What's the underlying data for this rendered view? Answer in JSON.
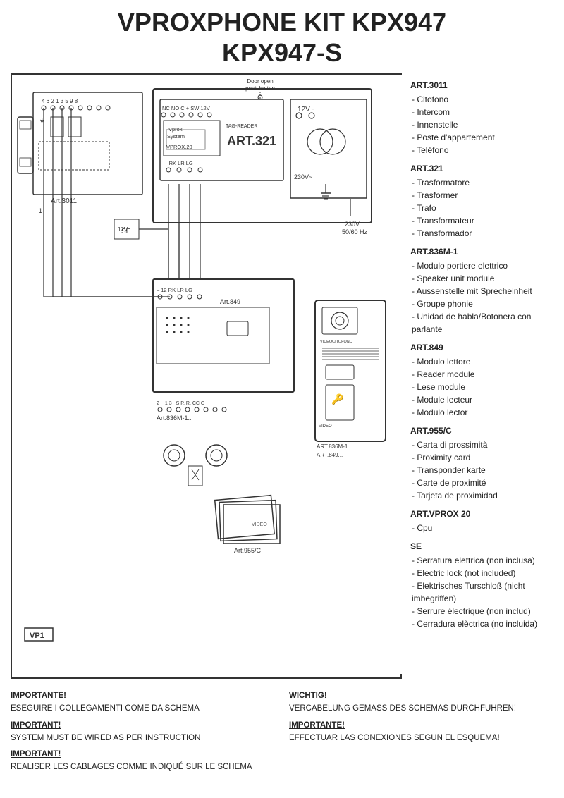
{
  "title": {
    "line1": "VPROXPHONE KIT KPX947",
    "line2": "KPX947-S"
  },
  "right_panel": {
    "sections": [
      {
        "id": "art3011",
        "title": "ART.3011",
        "items": [
          "Citofono",
          "Intercom",
          "Innenstelle",
          "Poste d'appartement",
          "Teléfono"
        ]
      },
      {
        "id": "art321",
        "title": "ART.321",
        "items": [
          "Trasformatore",
          "Trasformer",
          "Trafo",
          "Transformateur",
          "Transformador"
        ]
      },
      {
        "id": "art836m1",
        "title": "ART.836M-1",
        "items": [
          "Modulo portiere elettrico",
          "Speaker unit module",
          "Aussenstelle mit Sprecheinheit",
          "Groupe phonie",
          "Unidad de habla/Botonera con  parlante"
        ]
      },
      {
        "id": "art849",
        "title": "ART.849",
        "items": [
          "Modulo lettore",
          "Reader module",
          "Lese module",
          "Module lecteur",
          "Modulo lector"
        ]
      },
      {
        "id": "art955c",
        "title": "ART.955/C",
        "items": [
          "Carta di prossimità",
          "Proximity card",
          "Transponder karte",
          "Carte de proximité",
          "Tarjeta de proximidad"
        ]
      },
      {
        "id": "artvprox20",
        "title": "ART.VPROX 20",
        "items": [
          "Cpu"
        ]
      },
      {
        "id": "se",
        "title": "SE",
        "items": [
          "Serratura elettrica (non inclusa)",
          "Electric lock (not included)",
          "Elektrisches Turschloß (nicht imbegriffen)",
          "Serrure électrique (non includ)",
          "Cerradura elèctrica (no incluida)"
        ]
      }
    ]
  },
  "bottom_notes": {
    "col1": [
      {
        "heading": "IMPORTANTE!",
        "text": "ESEGUIRE I COLLEGAMENTI COME DA SCHEMA"
      },
      {
        "heading": "IMPORTANT!",
        "text": "SYSTEM MUST BE WIRED AS PER INSTRUCTION"
      },
      {
        "heading": "IMPORTANT!",
        "text": "REALISER LES CABLAGES COMME INDIQUÉ SUR LE SCHEMA"
      }
    ],
    "col2": [
      {
        "heading": "WICHTIG!",
        "text": "VERCABELUNG GEMASS DES SCHEMAS DURCHFUHREN!"
      },
      {
        "heading": "IMPORTANTE!",
        "text": "EFFECTUAR LAS CONEXIONES SEGUN EL ESQUEMA!"
      }
    ]
  },
  "diagram": {
    "vp1_label": "VP1",
    "door_open_label": "Door open\npush button",
    "art321_label": "ART.321",
    "art849_label": "Art.849",
    "art836m1_label": "Art.836M-1..",
    "art849_bottom_label": "ART.849...",
    "art836m1_bottom_label": "ART.836M-1..",
    "art955c_label": "Art.955/C",
    "art3011_label": "Art.3011",
    "vprox20_label": "VPROX.20",
    "voltage_label": "230V\n50/60 Hz",
    "se_label": "SE",
    "num1_label": "1",
    "rk_lr_lg_label": "– RK LR LG",
    "terminals_label": "NC NO C  +  SW  12V",
    "vprox_system_label": "Vprox\nSystem",
    "tag_reader_label": "TAG-READER",
    "transform_12v": "12V~",
    "transform_230v": "230V~",
    "terminal_row2": "2  ~  1  3~  S  P,  R,  CC  C"
  }
}
